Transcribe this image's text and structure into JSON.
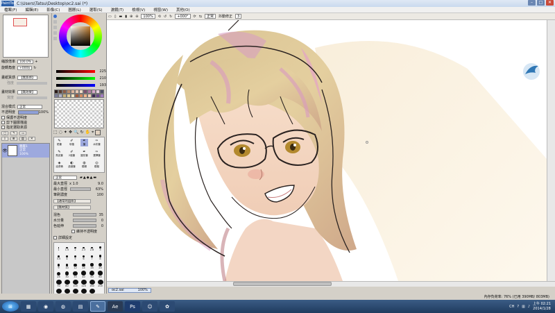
{
  "window": {
    "app_logo": "PaintTool SAI",
    "title": "C:\\Users\\Tatsu\\Desktop\\oc2.sai (*)",
    "minimize": "–",
    "maximize": "□",
    "close": "✕"
  },
  "menu": [
    "檔案(F)",
    "編輯(E)",
    "影像(C)",
    "圖層(L)",
    "選取(S)",
    "濾鏡(T)",
    "檢視(V)",
    "視窗(W)",
    "其他(O)"
  ],
  "toolbar": {
    "zoom": "100%",
    "flip_label": "翻面邊緣",
    "rotation": "+000°",
    "mode": "正常",
    "stabilizer_label": "抖動修正",
    "stabilizer_value": "3"
  },
  "navigator": {
    "zoom_label": "縮放倍率",
    "zoom_value": "100.0%",
    "angle_label": "旋轉角度",
    "angle_value": "+000$"
  },
  "paper": {
    "texture_label": "畫紙質感",
    "texture_value": "【無質感】",
    "effect_label": "畫材效果",
    "effect_value": "【無效果】",
    "strength_label": "強度",
    "width_label": "寬度"
  },
  "layer": {
    "blend_label": "混合模式",
    "blend_value": "正常",
    "opacity_label": "不透明度",
    "opacity_value": "100%",
    "protect_label": "保護不透明度",
    "clip_label": "剪下圖層描邊",
    "selection_label": "指定選取來源",
    "items": [
      {
        "name": "圖層1",
        "mode": "正常",
        "opacity": "100%"
      }
    ]
  },
  "color": {
    "rgb_values": [
      "225",
      "210",
      "193"
    ],
    "palette_colors": [
      "#2b1a17",
      "#5a3b30",
      "#8c5b45",
      "#b98a6c",
      "#d9b39a",
      "#e8c9b5",
      "#f2dcc9",
      "#7a4f6e",
      "#b37aa1",
      "#d6a6c8",
      "#e9d1e2",
      "#4d4d66",
      "#7d7d99",
      "#b0b0c8",
      "#c7b07a",
      "#e1cc96",
      "#f0e5c2",
      "#a05a3c",
      "#d18a60",
      "#f2b48c",
      "#f6d2b5",
      "#402a55",
      "#6e4a8c",
      "#a37cc2"
    ]
  },
  "tools": {
    "row1": [
      "鉛筆",
      "噴槍",
      "筆",
      "水彩筆"
    ],
    "row2": [
      "馬克筆",
      "2值筆",
      "圓形筆",
      "選擇筆"
    ],
    "row3": [
      "油漆桶",
      "過渡筆",
      "模糊",
      "模擬"
    ]
  },
  "brush": {
    "mode": "正常",
    "max_size_label": "最大直徑",
    "max_size_mult": "x 1.0",
    "max_size_value": "9.0",
    "min_size_label": "最小直徑",
    "min_size_value": "63%",
    "density_label": "筆刷濃度",
    "density_value": "100",
    "shape_value": "【通常的圓形】",
    "texture_value": "【無材質】",
    "blending_label": "混色",
    "blending_value": "35",
    "dilution_label": "水分量",
    "dilution_value": "0",
    "persistence_label": "色延伸",
    "persistence_value": "0",
    "keep_opacity_label": "維持不透明度",
    "advanced_label": "詳細設定",
    "sizes": [
      "1",
      "1.5",
      "2",
      "2.3",
      "2.6",
      "3",
      "3.5",
      "4",
      "5",
      "6",
      "7",
      "8",
      "9",
      "10",
      "12",
      "14",
      "16",
      "20",
      "25",
      "30",
      "35",
      "40",
      "50",
      "60",
      "70",
      "80",
      "100",
      "120",
      "160",
      "200",
      "250",
      "300",
      "350",
      "400",
      "500"
    ]
  },
  "doc_tab": {
    "name": "oc2.sai",
    "zoom": "100%"
  },
  "status": {
    "memory": "內存負荷率: 76% (已用 390MB/ 803MB)"
  },
  "taskbar": {
    "tray_lang": "CH",
    "time": "上午 02:21",
    "date": "2014/1/28",
    "start_label": "⊞"
  },
  "colors": {
    "titlebar": "#c9d9ee",
    "close_red": "#c94a3a",
    "taskbar": "#1f3b5e",
    "selection_blue": "#dfe8f6"
  }
}
